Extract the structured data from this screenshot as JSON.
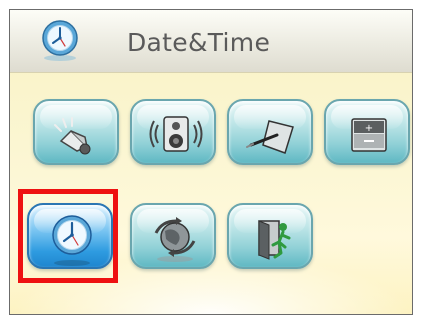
{
  "header": {
    "title": "Date&Time",
    "icon": "clock-icon"
  },
  "menu": {
    "items": [
      {
        "name": "volume-button",
        "icon": "speaker-horn-icon"
      },
      {
        "name": "sound-button",
        "icon": "loudspeaker-icon"
      },
      {
        "name": "calibration-button",
        "icon": "stylus-screen-icon"
      },
      {
        "name": "battery-button",
        "icon": "battery-icon"
      },
      {
        "name": "date-time-button",
        "icon": "clock-icon",
        "selected": true
      },
      {
        "name": "language-button",
        "icon": "globe-arrows-icon"
      },
      {
        "name": "exit-button",
        "icon": "exit-door-icon"
      }
    ]
  },
  "colors": {
    "highlight": "#ee1111",
    "accent_selected": "#2e9be0",
    "accent": "#8fd0d6"
  }
}
